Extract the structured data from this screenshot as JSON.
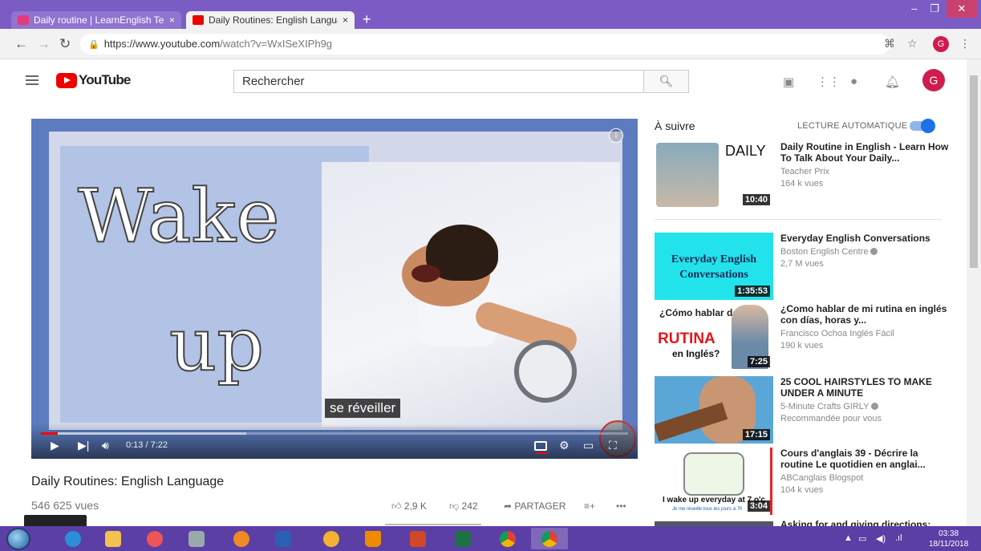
{
  "browser": {
    "tabs": [
      {
        "title": "Daily routine | LearnEnglish Teen",
        "close": "×"
      },
      {
        "title": "Daily Routines: English Language",
        "close": "×"
      }
    ],
    "new_tab": "+",
    "url_host": "https://www.youtube.com",
    "url_path": "/watch?v=WxISeXIPh9g",
    "profile_initial": "G"
  },
  "header": {
    "logo_text": "YouTube",
    "search_placeholder": "Rechercher",
    "avatar_initial": "G"
  },
  "player": {
    "big_text_line1": "Wake",
    "big_text_line2": "up",
    "subtitle": "se réveiller",
    "time": "0:13 / 7:22",
    "progress_fraction": 0.029,
    "buffered_fraction": 0.35
  },
  "video": {
    "title": "Daily Routines: English Language",
    "views": "546 625 vues",
    "likes": "2,9 K",
    "dislikes": "242",
    "share": "PARTAGER"
  },
  "sidebar": {
    "up_next": "À suivre",
    "autoplay": "LECTURE AUTOMATIQUE",
    "items": [
      {
        "title": "Daily Routine in English - Learn How To Talk About Your Daily...",
        "channel": "Teacher Prix",
        "views": "164 k vues",
        "duration": "10:40",
        "thumb_text": "DAILY"
      },
      {
        "title": "Everyday English Conversations",
        "channel": "Boston English Centre",
        "views": "2,7 M vues",
        "duration": "1:35:53",
        "thumb_text": "Everyday English Conversations"
      },
      {
        "title": "¿Como hablar de mi rutina en inglés con días, horas y...",
        "channel": "Francisco Ochoa Inglés Fácil",
        "views": "190 k vues",
        "duration": "7:25",
        "thumb_text_a": "¿Cómo hablar de mi",
        "thumb_text_b": "RUTINA",
        "thumb_text_c": "en Inglés?"
      },
      {
        "title": "25 COOL HAIRSTYLES TO MAKE UNDER A MINUTE",
        "channel": "5-Minute Crafts GIRLY",
        "views": "Recommandée pour vous",
        "duration": "17:15"
      },
      {
        "title": "Cours d'anglais 39 - Décrire la routine Le quotidien en anglai...",
        "channel": "ABCanglais Blogspot",
        "views": "104 k vues",
        "duration": "3:04",
        "thumb_text": "I wake up everyday at 7 o'c",
        "thumb_text_small": "Je me réveille tous les jours à 7h"
      }
    ],
    "partial_title": "Asking for and giving directions:"
  },
  "taskbar": {
    "time": "03:38",
    "date": "18/11/2018"
  },
  "colors": {
    "chrome_purple": "#7b5cc5",
    "youtube_red": "#ee0000",
    "toggle_blue": "#1a73e8",
    "avatar": "#d01b4e"
  }
}
